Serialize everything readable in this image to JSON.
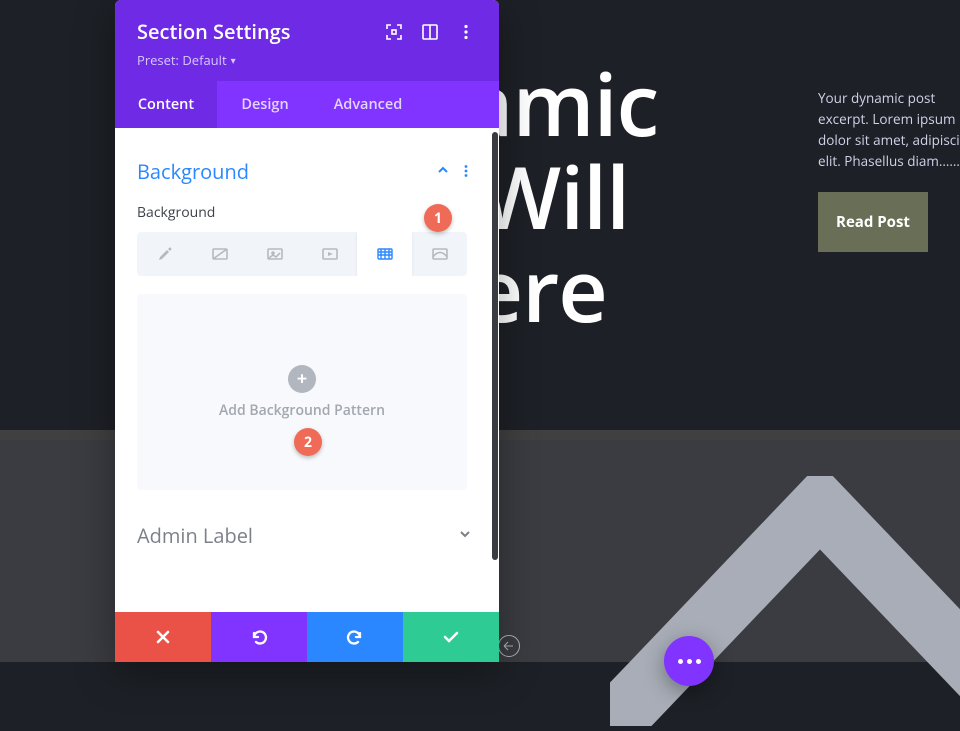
{
  "hero": {
    "title_lines": [
      "namic",
      "e Will",
      "Here"
    ],
    "excerpt": "Your dynamic post excerpt. Lorem ipsum dolor sit amet, adipiscing elit. Phasellus diam……",
    "read_post_label": "Read Post"
  },
  "panel": {
    "title": "Section Settings",
    "preset_label": "Preset: Default",
    "tabs": {
      "content": "Content",
      "design": "Design",
      "advanced": "Advanced"
    },
    "background": {
      "title": "Background",
      "field_label": "Background",
      "options": [
        "color",
        "gradient",
        "image",
        "video",
        "pattern",
        "mask"
      ],
      "active_index": 4,
      "dropzone_label": "Add Background Pattern"
    },
    "admin_label_title": "Admin Label"
  },
  "annotations": {
    "one": "1",
    "two": "2"
  },
  "colors": {
    "purple_dark": "#6e2ae4",
    "purple": "#8134ff",
    "blue": "#2a87ff",
    "green": "#2ecb94",
    "red": "#ea5247",
    "orange": "#ef6b57",
    "olive": "#686f56"
  }
}
